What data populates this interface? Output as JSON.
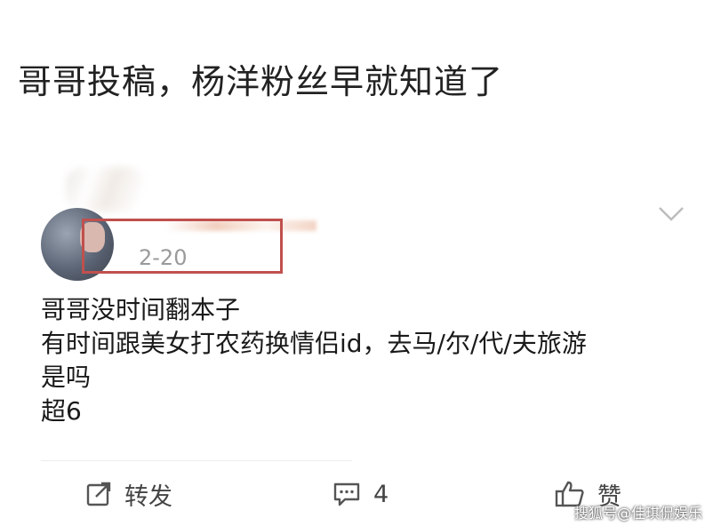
{
  "heading": "哥哥投稿，杨洋粉丝早就知道了",
  "post": {
    "date": "2-20",
    "lines": [
      "哥哥没时间翻本子",
      "有时间跟美女打农药换情侣id，去马/尔/代/夫旅游",
      "是吗",
      "超6"
    ]
  },
  "actions": {
    "repost_label": "转发",
    "comment_count": "4",
    "like_label": "赞"
  },
  "watermark": "搜狐号@佳琪侃娱乐",
  "colors": {
    "highlight_box": "#c0504d",
    "date_text": "#9a9a9a",
    "icon": "#555555"
  },
  "icons": {
    "expand": "chevron-down-icon",
    "repost": "repost-icon",
    "comment": "comment-icon",
    "like": "thumbs-up-icon"
  }
}
